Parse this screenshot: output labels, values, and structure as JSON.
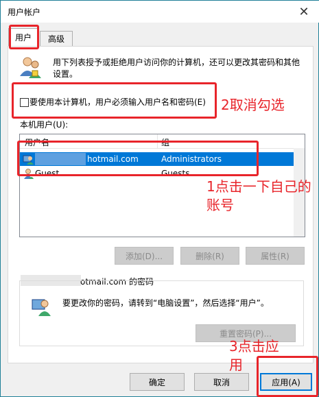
{
  "window": {
    "title": "用户帐户",
    "close_glyph": "✕"
  },
  "tabs": [
    {
      "label": "用户"
    },
    {
      "label": "高级"
    }
  ],
  "description": "用下列表授予或拒绝用户访问你的计算机，还可以更改其密码和其他设置。",
  "checkbox": {
    "label": "要使用本计算机，用户必须输入用户名和密码(E)",
    "checked": false
  },
  "local_users_label": "本机用户(U):",
  "table": {
    "headers": [
      "用户名",
      "组"
    ],
    "rows": [
      {
        "name": "hotmail.com",
        "group": "Administrators",
        "selected": true
      },
      {
        "name": "Guest",
        "group": "Guests",
        "selected": false
      }
    ]
  },
  "list_buttons": {
    "add": "添加(D)...",
    "remove": "删除(R)",
    "properties": "属性(R)"
  },
  "password_group": {
    "title": "otmail.com 的密码",
    "text": "要更改你的密码，请转到“电脑设置”，然后选择“用户”。",
    "reset_button": "重置密码(P)..."
  },
  "footer": {
    "ok": "确定",
    "cancel": "取消",
    "apply": "应用(A)"
  },
  "annotations": {
    "step1": "1点击一下自己的账号",
    "step2": "2取消勾选",
    "step3": "3点击应用"
  },
  "colors": {
    "annotation": "#e8242a",
    "selection": "#0078d7"
  }
}
